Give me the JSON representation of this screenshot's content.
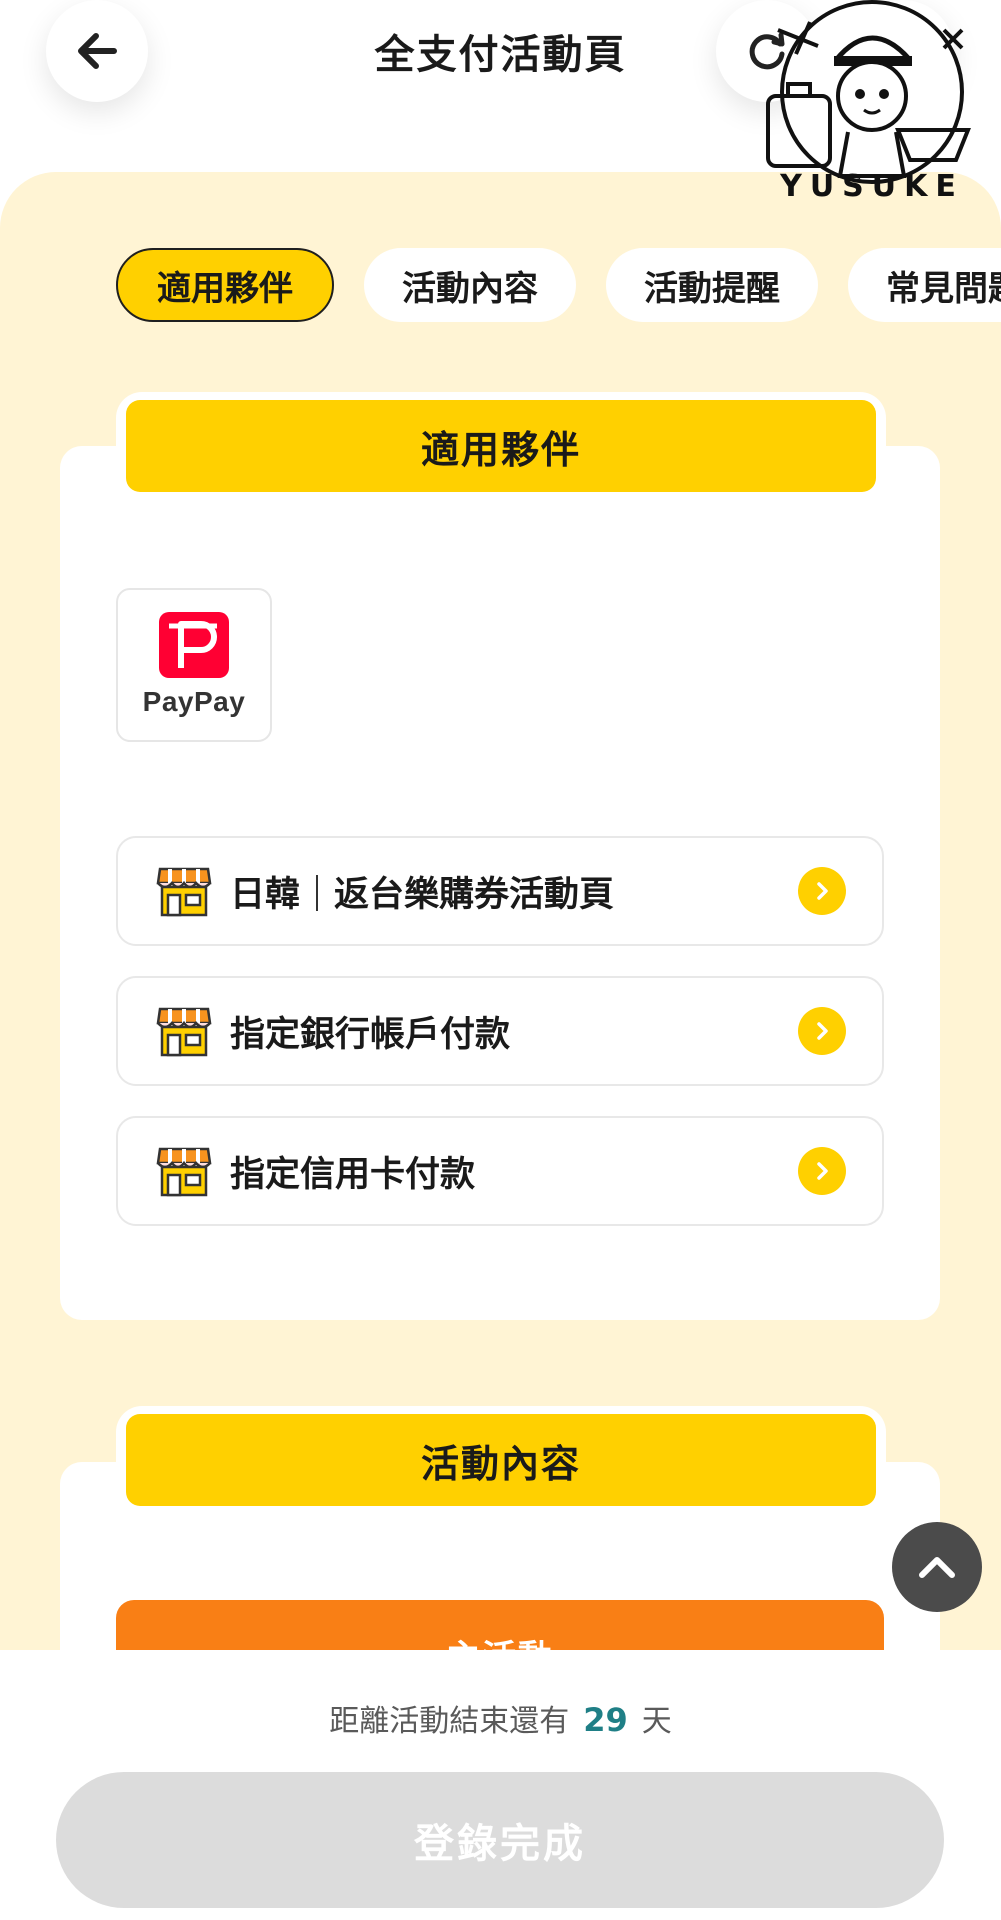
{
  "header": {
    "title": "全支付活動頁"
  },
  "watermark": {
    "text": "YUSUKE"
  },
  "tabs": [
    {
      "label": "適用夥伴",
      "active": true
    },
    {
      "label": "活動內容",
      "active": false
    },
    {
      "label": "活動提醒",
      "active": false
    },
    {
      "label": "常見問題",
      "active": false
    }
  ],
  "partners_section": {
    "title": "適用夥伴",
    "partner_logo": {
      "name": "PayPay",
      "icon": "paypay-logo"
    }
  },
  "links": [
    {
      "label_left": "日韓",
      "label_right": "返台樂購券活動頁"
    },
    {
      "label": "指定銀行帳戶付款"
    },
    {
      "label": "指定信用卡付款"
    }
  ],
  "content_section": {
    "title": "活動內容",
    "main_event_label": "主活動"
  },
  "footer": {
    "countdown_prefix": "距離活動結束還有",
    "countdown_days": "29",
    "countdown_suffix": "天",
    "register_label": "登錄完成"
  },
  "colors": {
    "accent_yellow": "#ffd000",
    "panel_cream": "#fff4d4",
    "orange": "#f97f15",
    "countdown_teal": "#1f7f86",
    "disabled_gray": "#dcdcdc"
  }
}
